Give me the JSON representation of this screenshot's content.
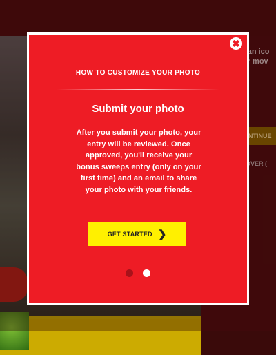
{
  "background": {
    "hint_text": "t an ico\nor mov",
    "continue_label": "NTINUE",
    "over_label": "OVER ("
  },
  "modal": {
    "close_icon": "close-icon",
    "eyebrow": "HOW TO CUSTOMIZE YOUR PHOTO",
    "title": "Submit your photo",
    "body": "After you submit your photo, your entry will be reviewed. Once approved, you'll receive your bonus sweeps entry (only on your first time) and an email to share your photo with your friends.",
    "cta_label": "GET STARTED",
    "cta_icon": "chevron-right-icon",
    "pagination": {
      "current": 2,
      "total": 2
    }
  },
  "colors": {
    "modal_red": "#ee1c25",
    "cta_yellow": "#fff000",
    "dot_inactive": "#a8121a",
    "dot_active": "#ffffff"
  }
}
